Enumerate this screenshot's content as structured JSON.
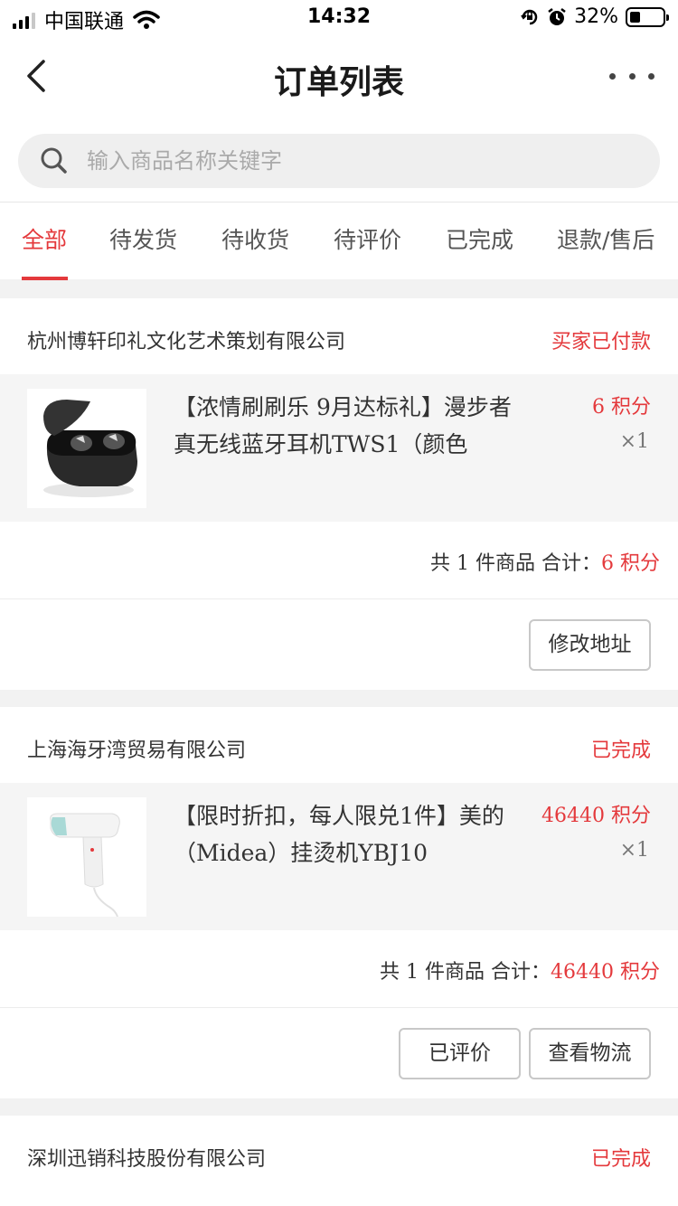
{
  "status_bar": {
    "carrier": "中国联通",
    "time": "14:32",
    "battery": "32%"
  },
  "nav": {
    "title": "订单列表"
  },
  "search": {
    "placeholder": "输入商品名称关键字"
  },
  "tabs": [
    {
      "label": "全部",
      "active": true
    },
    {
      "label": "待发货",
      "active": false
    },
    {
      "label": "待收货",
      "active": false
    },
    {
      "label": "待评价",
      "active": false
    },
    {
      "label": "已完成",
      "active": false
    },
    {
      "label": "退款/售后",
      "active": false
    }
  ],
  "orders": [
    {
      "shop": "杭州博轩印礼文化艺术策划有限公司",
      "status": "买家已付款",
      "item": {
        "title": "【浓情刷刷乐 9月达标礼】漫步者真无线蓝牙耳机TWS1（颜色",
        "price": "6 积分",
        "qty": "×1",
        "image": "earbuds-case"
      },
      "summary_prefix": "共 1 件商品 合计：",
      "summary_total": "6 积分",
      "actions": [
        "修改地址"
      ]
    },
    {
      "shop": "上海海牙湾贸易有限公司",
      "status": "已完成",
      "item": {
        "title": "【限时折扣，每人限兑1件】美的（Midea）挂烫机YBJ10",
        "price": "46440 积分",
        "qty": "×1",
        "image": "garment-steamer"
      },
      "summary_prefix": "共 1 件商品 合计：",
      "summary_total": "46440 积分",
      "actions": [
        "已评价",
        "查看物流"
      ]
    },
    {
      "shop": "深圳迅销科技股份有限公司",
      "status": "已完成"
    }
  ],
  "colors": {
    "accent": "#e4393c",
    "background": "#f2f2f2",
    "item_background": "#f5f5f5"
  }
}
